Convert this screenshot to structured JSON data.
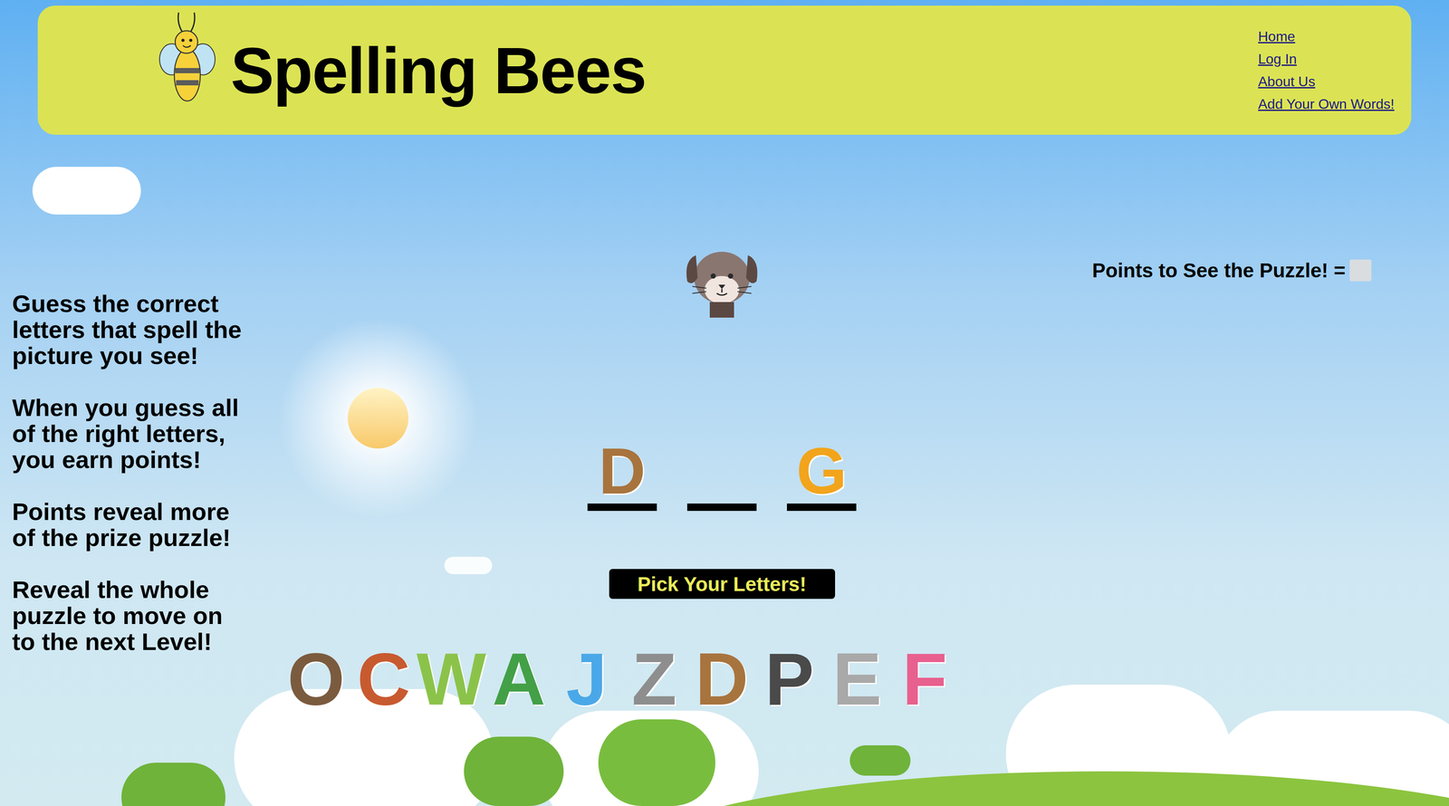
{
  "header": {
    "title": "Spelling Bees",
    "nav": [
      "Home",
      "Log In",
      "About Us",
      "Add Your Own Words!"
    ]
  },
  "instructions": [
    "Guess the correct letters that spell the picture you see!",
    "When you guess all of the right letters, you earn points!",
    "Points reveal more of the prize puzzle!",
    "Reveal the whole puzzle to move on to the next Level!"
  ],
  "points": {
    "label": "Points to See the Puzzle! ="
  },
  "word": {
    "slots": [
      {
        "letter": "D",
        "revealed": true,
        "color": "#a8743e"
      },
      {
        "letter": "",
        "revealed": false,
        "color": "#000000"
      },
      {
        "letter": "G",
        "revealed": true,
        "color": "#f2a41c"
      }
    ]
  },
  "button": "Pick Your Letters!",
  "letters": [
    {
      "letter": "O",
      "color": "#7b5b3e"
    },
    {
      "letter": "C",
      "color": "#c85a30"
    },
    {
      "letter": "W",
      "color": "#8bc34a"
    },
    {
      "letter": "A",
      "color": "#43a047"
    },
    {
      "letter": "J",
      "color": "#4aa8e8"
    },
    {
      "letter": "Z",
      "color": "#8e8e8e"
    },
    {
      "letter": "D",
      "color": "#a8743e"
    },
    {
      "letter": "P",
      "color": "#4a4a4a"
    },
    {
      "letter": "E",
      "color": "#a9a9a9"
    },
    {
      "letter": "F",
      "color": "#e8608e"
    }
  ]
}
